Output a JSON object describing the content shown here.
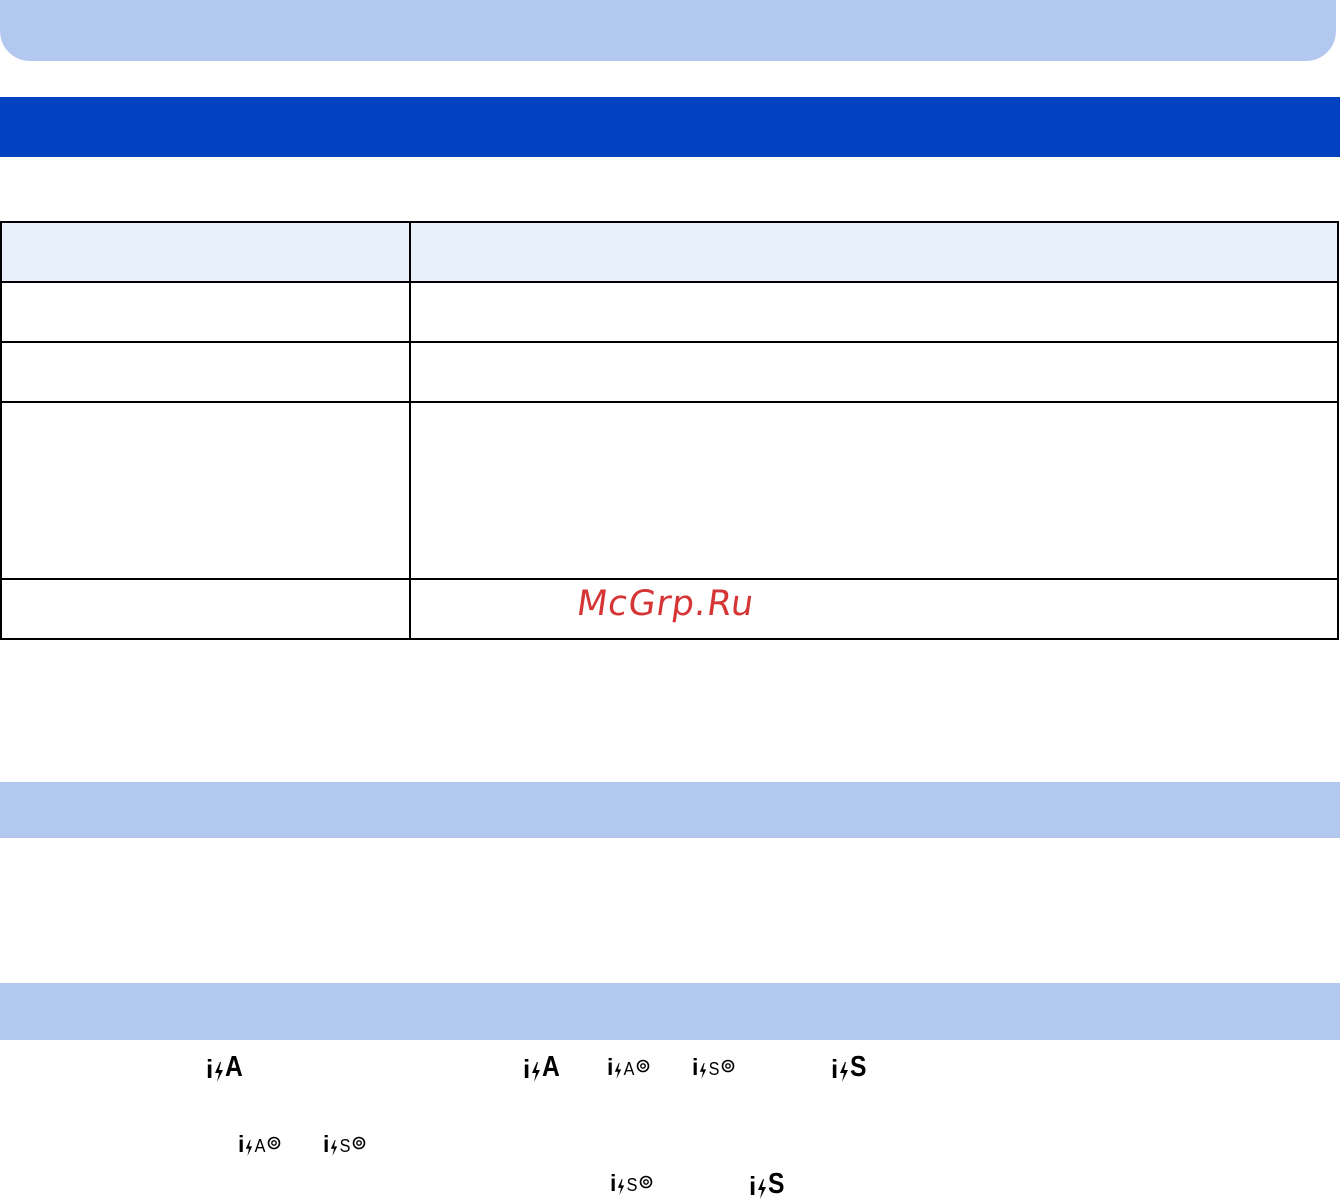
{
  "watermark": {
    "text": "McGrp.Ru",
    "color": "#d42b2b"
  },
  "colors": {
    "banner": "#b3c8ee",
    "section_dark": "#0142c0",
    "table_header": "#e8f0fb"
  },
  "icons": [
    {
      "name": "intelligent-flash-auto-icon",
      "letter": "A",
      "variant": "large"
    },
    {
      "name": "intelligent-flash-auto-icon",
      "letter": "A",
      "variant": "large"
    },
    {
      "name": "intelligent-flash-auto-redeye-icon",
      "letter": "A",
      "variant": "small-redeye"
    },
    {
      "name": "intelligent-flash-slow-redeye-icon",
      "letter": "S",
      "variant": "small-redeye"
    },
    {
      "name": "intelligent-flash-slow-icon",
      "letter": "S",
      "variant": "large"
    },
    {
      "name": "intelligent-flash-auto-redeye-icon",
      "letter": "A",
      "variant": "small-redeye"
    },
    {
      "name": "intelligent-flash-slow-redeye-icon",
      "letter": "S",
      "variant": "small-redeye"
    },
    {
      "name": "intelligent-flash-slow-redeye-icon",
      "letter": "S",
      "variant": "small-redeye"
    },
    {
      "name": "intelligent-flash-slow-icon",
      "letter": "S",
      "variant": "large"
    }
  ]
}
